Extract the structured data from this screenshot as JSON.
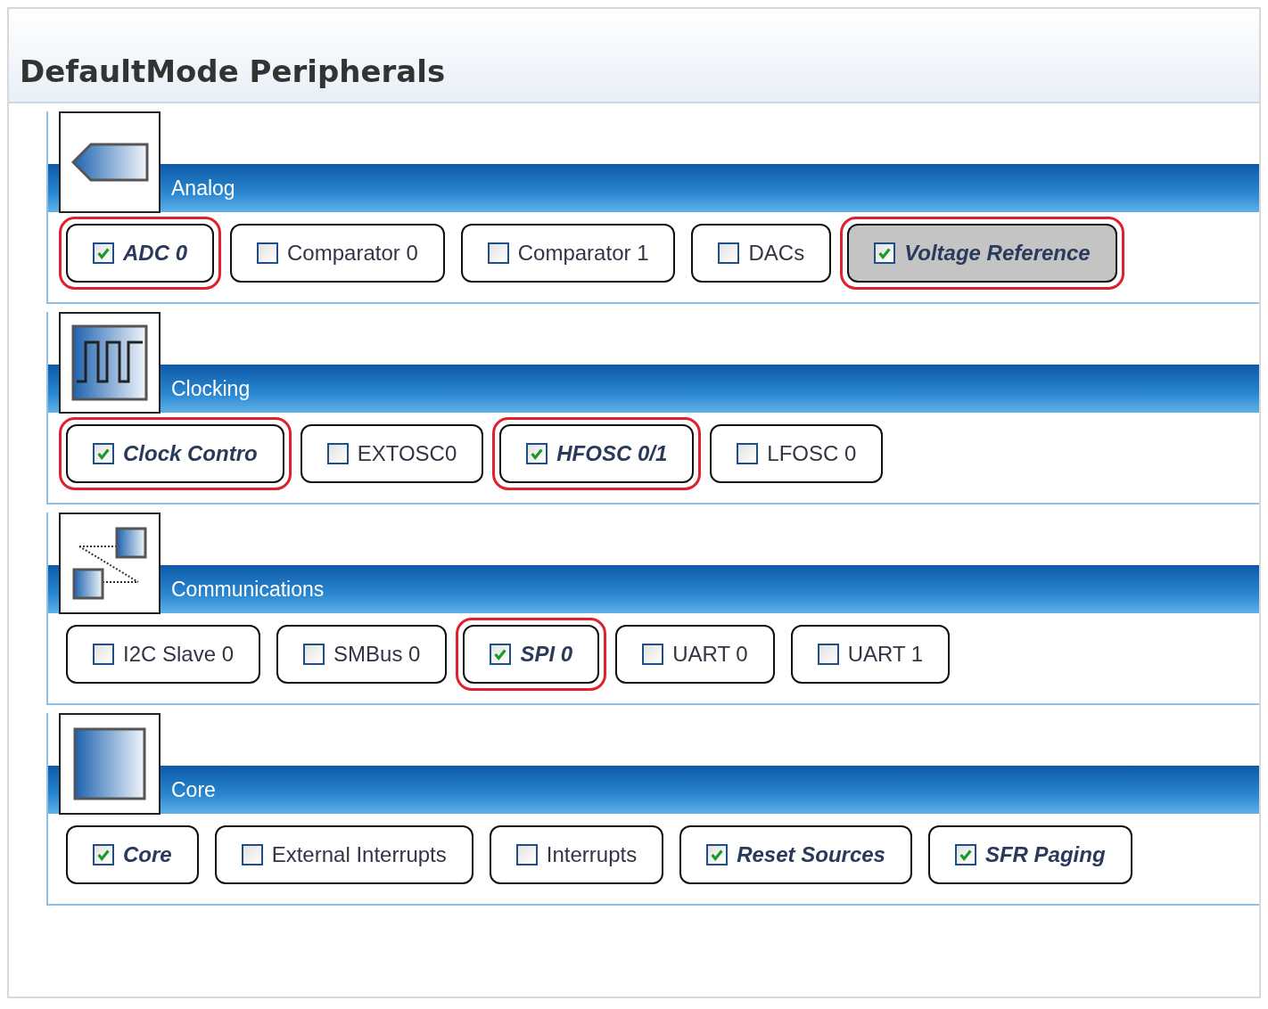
{
  "title": "DefaultMode Peripherals",
  "sections": [
    {
      "name": "Analog",
      "items": [
        {
          "label": "ADC 0",
          "checked": true,
          "circled": true,
          "selected": false
        },
        {
          "label": "Comparator 0",
          "checked": false,
          "circled": false,
          "selected": false
        },
        {
          "label": "Comparator 1",
          "checked": false,
          "circled": false,
          "selected": false
        },
        {
          "label": "DACs",
          "checked": false,
          "circled": false,
          "selected": false
        },
        {
          "label": "Voltage Reference",
          "checked": true,
          "circled": true,
          "selected": true
        }
      ]
    },
    {
      "name": "Clocking",
      "items": [
        {
          "label": "Clock Contro",
          "checked": true,
          "circled": true,
          "selected": false
        },
        {
          "label": "EXTOSC0",
          "checked": false,
          "circled": false,
          "selected": false
        },
        {
          "label": "HFOSC 0/1",
          "checked": true,
          "circled": true,
          "selected": false
        },
        {
          "label": "LFOSC 0",
          "checked": false,
          "circled": false,
          "selected": false
        }
      ]
    },
    {
      "name": "Communications",
      "items": [
        {
          "label": "I2C Slave 0",
          "checked": false,
          "circled": false,
          "selected": false
        },
        {
          "label": "SMBus 0",
          "checked": false,
          "circled": false,
          "selected": false
        },
        {
          "label": "SPI 0",
          "checked": true,
          "circled": true,
          "selected": false
        },
        {
          "label": "UART 0",
          "checked": false,
          "circled": false,
          "selected": false
        },
        {
          "label": "UART 1",
          "checked": false,
          "circled": false,
          "selected": false
        }
      ]
    },
    {
      "name": "Core",
      "items": [
        {
          "label": "Core",
          "checked": true,
          "circled": false,
          "selected": false
        },
        {
          "label": "External Interrupts",
          "checked": false,
          "circled": false,
          "selected": false
        },
        {
          "label": "Interrupts",
          "checked": false,
          "circled": false,
          "selected": false
        },
        {
          "label": "Reset Sources",
          "checked": true,
          "circled": false,
          "selected": false
        },
        {
          "label": "SFR Paging",
          "checked": true,
          "circled": false,
          "selected": false
        }
      ]
    }
  ]
}
